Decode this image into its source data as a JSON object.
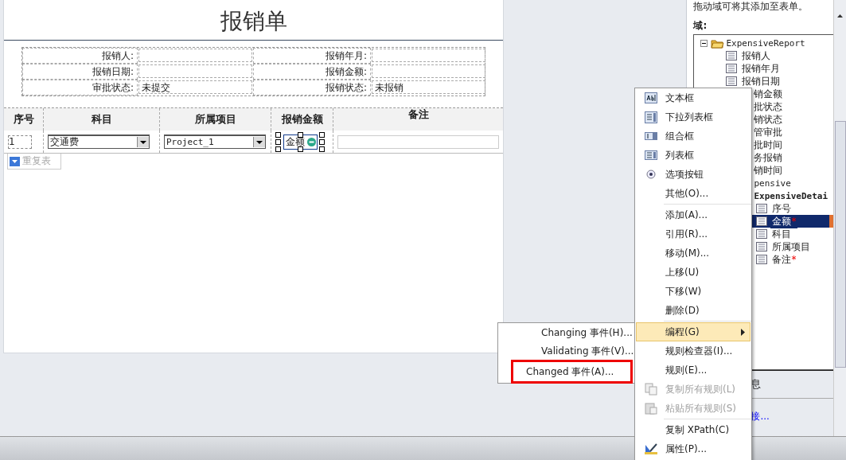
{
  "form": {
    "title": "报销单",
    "info_rows": [
      [
        {
          "label": "报销人:"
        },
        {
          "label": "报销年月:"
        }
      ],
      [
        {
          "label": "报销日期:"
        },
        {
          "label": "报销金额:"
        }
      ],
      [
        {
          "label": "审批状态:",
          "value": "未提交"
        },
        {
          "label": "报销状态:",
          "value": "未报销"
        }
      ]
    ],
    "table": {
      "columns": [
        "序号",
        "科目",
        "所属项目",
        "报销金额",
        "备注"
      ],
      "cells": [
        {
          "kind": "text",
          "value": "1"
        },
        {
          "kind": "dropdown",
          "value": "交通费"
        },
        {
          "kind": "dropdown",
          "value": "Project_1"
        },
        {
          "kind": "selected",
          "value": "金额"
        },
        {
          "kind": "input"
        }
      ],
      "repeat_tag": "重复表"
    }
  },
  "fields_panel": {
    "hint": "拖动域可将其添加至表单。",
    "label": "域:",
    "tree": [
      {
        "label": "ExpensiveReport",
        "kind": "folder",
        "expanded": true,
        "children": [
          {
            "label": "报销人",
            "kind": "field"
          },
          {
            "label": "报销年月",
            "kind": "field"
          },
          {
            "label": "报销日期",
            "kind": "field"
          },
          {
            "label": "销金额",
            "kind": "cut"
          },
          {
            "label": "批状态",
            "kind": "cut"
          },
          {
            "label": "销状态",
            "kind": "cut"
          },
          {
            "label": "管审批",
            "kind": "cut"
          },
          {
            "label": "批时间",
            "kind": "cut"
          },
          {
            "label": "务报销",
            "kind": "cut"
          },
          {
            "label": "销时间",
            "kind": "cut"
          },
          {
            "label": "pensive",
            "kind": "cut",
            "children": [
              {
                "label": "ExpensiveDetai",
                "kind": "repeat",
                "children": [
                  {
                    "label": "序号",
                    "kind": "field",
                    "selected": false
                  },
                  {
                    "label": "金额",
                    "kind": "field",
                    "required_mark": "*",
                    "selected": true
                  },
                  {
                    "label": "科目",
                    "kind": "field",
                    "selected": false
                  },
                  {
                    "label": "所属项目",
                    "kind": "field",
                    "selected": false
                  },
                  {
                    "label": "备注",
                    "kind": "field",
                    "required_mark": "*",
                    "selected": false
                  }
                ]
              }
            ]
          }
        ]
      }
    ],
    "info": "息",
    "link": "接..."
  },
  "context_menu": {
    "groups": [
      [
        {
          "label": "文本框"
        },
        {
          "label": "下拉列表框"
        },
        {
          "label": "组合框"
        },
        {
          "label": "列表框"
        },
        {
          "label": "选项按钮"
        },
        {
          "label": "其他(O)..."
        }
      ],
      [
        {
          "label": "添加(A)..."
        },
        {
          "label": "引用(R)..."
        },
        {
          "label": "移动(M)..."
        },
        {
          "label": "上移(U)"
        },
        {
          "label": "下移(W)"
        },
        {
          "label": "删除(D)"
        }
      ],
      [
        {
          "label": "编程(G)",
          "submenu": true,
          "selected": true,
          "disabled": false
        },
        {
          "label": "规则检查器(I)..."
        },
        {
          "label": "规则(E)..."
        },
        {
          "label": "复制所有规则(L)",
          "disabled": true
        },
        {
          "label": "粘贴所有规则(S)",
          "disabled": true
        }
      ],
      [
        {
          "label": "复制 XPath(C)"
        },
        {
          "label": "属性(P)..."
        }
      ]
    ]
  },
  "submenu": {
    "items": [
      {
        "label": "Changing 事件(H)...",
        "annotated": false
      },
      {
        "label": "Validating 事件(V)...",
        "annotated": false
      },
      {
        "label": "Changed 事件(A)...",
        "annotated": true
      }
    ]
  }
}
